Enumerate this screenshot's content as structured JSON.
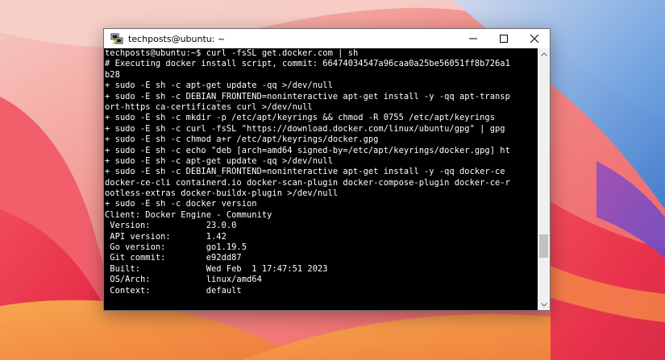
{
  "window": {
    "title": "techposts@ubuntu: ~",
    "icon": "putty-terminal-icon",
    "controls": [
      "minimize-icon",
      "maximize-icon",
      "close-icon"
    ]
  },
  "terminal": {
    "lines": [
      "techposts@ubuntu:~$ curl -fsSL get.docker.com | sh",
      "# Executing docker install script, commit: 66474034547a96caa0a25be56051ff8b726a1",
      "b28",
      "+ sudo -E sh -c apt-get update -qq >/dev/null",
      "+ sudo -E sh -c DEBIAN_FRONTEND=noninteractive apt-get install -y -qq apt-transp",
      "ort-https ca-certificates curl >/dev/null",
      "+ sudo -E sh -c mkdir -p /etc/apt/keyrings && chmod -R 0755 /etc/apt/keyrings",
      "+ sudo -E sh -c curl -fsSL \"https://download.docker.com/linux/ubuntu/gpg\" | gpg",
      "+ sudo -E sh -c chmod a+r /etc/apt/keyrings/docker.gpg",
      "+ sudo -E sh -c echo \"deb [arch=amd64 signed-by=/etc/apt/keyrings/docker.gpg] ht",
      "+ sudo -E sh -c apt-get update -qq >/dev/null",
      "+ sudo -E sh -c DEBIAN_FRONTEND=noninteractive apt-get install -y -qq docker-ce",
      "docker-ce-cli containerd.io docker-scan-plugin docker-compose-plugin docker-ce-r",
      "ootless-extras docker-buildx-plugin >/dev/null",
      "+ sudo -E sh -c docker version",
      "Client: Docker Engine - Community",
      " Version:           23.0.0",
      " API version:       1.42",
      " Go version:        go1.19.5",
      " Git commit:        e92dd87",
      " Built:             Wed Feb  1 17:47:51 2023",
      " OS/Arch:           linux/amd64",
      " Context:           default",
      ""
    ]
  },
  "scrollbar": {
    "thumb_start_fraction": 0.73,
    "thumb_size_fraction": 0.1
  },
  "colors": {
    "terminal_bg": "#000000",
    "terminal_fg": "#ffffff",
    "titlebar_bg": "#ffffff",
    "wallpaper_red": "#f2566a",
    "wallpaper_blue": "#4d8fd8",
    "wallpaper_orange": "#f6a04a"
  }
}
